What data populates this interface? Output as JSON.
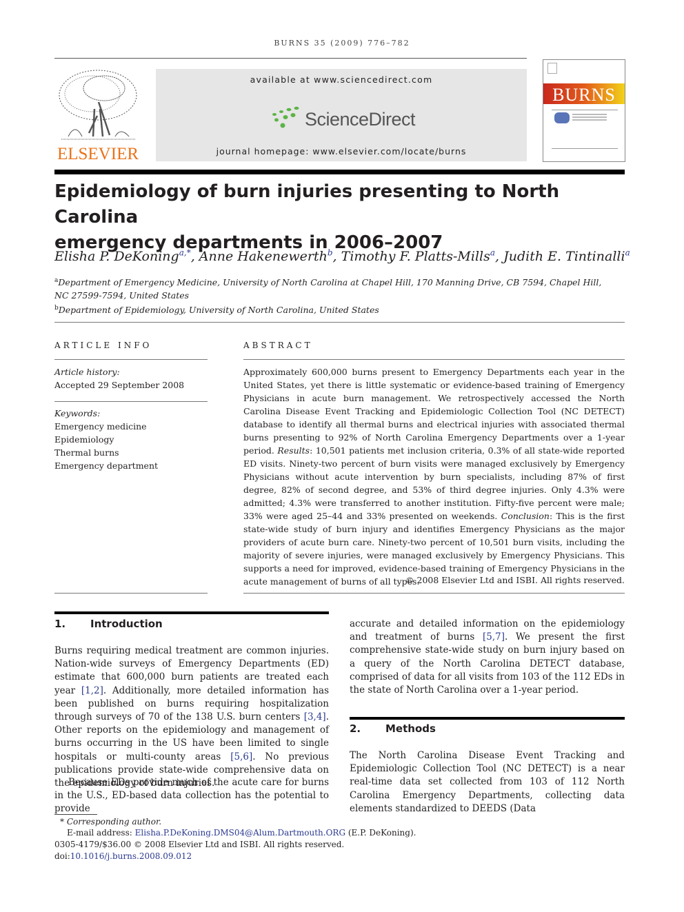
{
  "journal_header": {
    "running_head": "BURNS 35 (2009) 776–782",
    "publisher_logo_text": "ELSEVIER",
    "sciencedirect_available": "available at www.sciencedirect.com",
    "sciencedirect_brand": "ScienceDirect",
    "journal_homepage": "journal homepage: www.elsevier.com/locate/burns",
    "cover_title": "BURNS",
    "colors": {
      "elsevier_orange": "#e8731a",
      "sciencedirect_green": "#5db346",
      "link_blue": "#2b3990"
    }
  },
  "article": {
    "title_line1": "Epidemiology of burn injuries presenting to North Carolina",
    "title_line2": "emergency departments in 2006–2007",
    "authors": [
      {
        "name": "Elisha P. DeKoning",
        "sup": "a,*",
        "sep": ", "
      },
      {
        "name": "Anne Hakenewerth",
        "sup": "b",
        "sep": ", "
      },
      {
        "name": "Timothy F. Platts-Mills",
        "sup": "a",
        "sep": ", "
      },
      {
        "name": "Judith E. Tintinalli",
        "sup": "a",
        "sep": ""
      }
    ],
    "affiliations": [
      {
        "mark": "a",
        "text": "Department of Emergency Medicine, University of North Carolina at Chapel Hill, 170 Manning Drive, CB 7594, Chapel Hill,",
        "text2": "NC 27599-7594, United States"
      },
      {
        "mark": "b",
        "text": "Department of Epidemiology, University of North Carolina, United States"
      }
    ]
  },
  "article_info": {
    "heading": "ARTICLE INFO",
    "history_label": "Article history:",
    "history_value": "Accepted 29 September 2008",
    "keywords_label": "Keywords:",
    "keywords": [
      "Emergency medicine",
      "Epidemiology",
      "Thermal burns",
      "Emergency department"
    ]
  },
  "abstract": {
    "heading": "ABSTRACT",
    "part1": "Approximately 600,000 burns present to Emergency Departments each year in the United States, yet there is little systematic or evidence-based training of Emergency Physicians in acute burn management. We retrospectively accessed the North Carolina Disease Event Tracking and Epidemiologic Collection Tool (NC DETECT) database to identify all thermal burns and electrical injuries with associated thermal burns presenting to 92% of North Carolina Emergency Departments over a 1-year period. ",
    "results_label": "Results",
    "part2": ": 10,501 patients met inclusion criteria, 0.3% of all state-wide reported ED visits. Ninety-two percent of burn visits were managed exclusively by Emergency Physicians without acute intervention by burn specialists, including 87% of first degree, 82% of second degree, and 53% of third degree injuries. Only 4.3% were admitted; 4.3% were transferred to another institution. Fifty-five percent were male; 33% were aged 25–44 and 33% presented on weekends. ",
    "conclusion_label": "Conclusion",
    "part3": ": This is the first state-wide study of burn injury and identifies Emergency Physicians as the major providers of acute burn care. Ninety-two percent of 10,501 burn visits, including the majority of severe injuries, were managed exclusively by Emergency Physicians. This supports a need for improved, evidence-based training of Emergency Physicians in the acute management of burns of all types.",
    "copyright": "© 2008 Elsevier Ltd and ISBI. All rights reserved."
  },
  "sections": {
    "intro": {
      "number": "1.",
      "title": "Introduction",
      "p1_a": "Burns requiring medical treatment are common injuries. Nation-wide surveys of Emergency Departments (ED) estimate that 600,000 burn patients are treated each year ",
      "cite1": "[1,2]",
      "p1_b": ". Additionally, more detailed information has been published on burns requiring hospitalization through surveys of 70 of the 138 U.S. burn centers ",
      "cite2": "[3,4]",
      "p1_c": ". Other reports on the epidemiology and management of burns occurring in the US have been limited to single hospitals or multi-county areas ",
      "cite3": "[5,6]",
      "p1_d": ". No previous publications provide state-wide comprehensive data on the epidemiology of burn injuries.",
      "p2_a": "Because EDs provide much of the acute care for burns in the U.S., ED-based data collection has the potential to provide",
      "p2_b": "accurate and detailed information on the epidemiology and treatment of burns ",
      "cite4": "[5,7]",
      "p2_c": ". We present the first comprehensive state-wide study on burn injury based on a query of the North Carolina DETECT database, comprised of data for all visits from 103 of the 112 EDs in the state of North Carolina over a 1-year period."
    },
    "methods": {
      "number": "2.",
      "title": "Methods",
      "p1": "The North Carolina Disease Event Tracking and Epidemiologic Collection Tool (NC DETECT) is a near real-time data set collected from 103 of 112 North Carolina Emergency Departments, collecting data elements standardized to DEEDS (Data"
    }
  },
  "footnotes": {
    "corresponding_mark": "*",
    "corresponding_label": "Corresponding author.",
    "email_label": "E-mail address: ",
    "email": "Elisha.P.DeKoning.DMS04@Alum.Dartmouth.ORG",
    "email_suffix": " (E.P. DeKoning).",
    "issn_line": "0305-4179/$36.00 © 2008 Elsevier Ltd and ISBI. All rights reserved.",
    "doi_label": "doi:",
    "doi": "10.1016/j.burns.2008.09.012"
  }
}
